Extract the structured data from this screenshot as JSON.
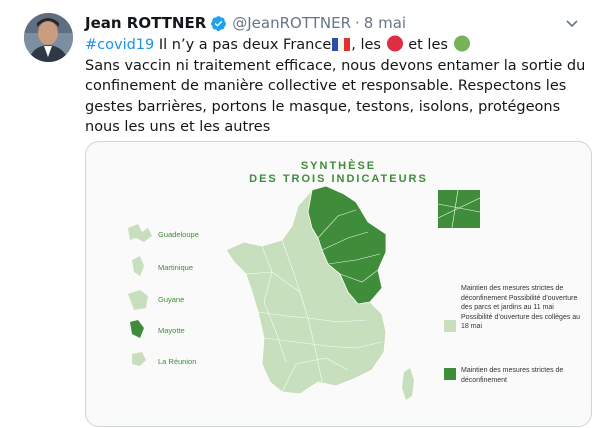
{
  "tweet": {
    "display_name": "Jean ROTTNER",
    "handle": "@JeanROTTNER",
    "separator": "·",
    "date": "8 mai",
    "text_hashtag": "#covid19",
    "text_line1_rest": " Il n’y a pas deux France",
    "text_line1_mid": ", les ",
    "text_line1_and": " et les ",
    "text_body": "Sans vaccin ni traitement efficace, nous devons entamer la sortie du confinement de manière collective et responsable. Respectons les gestes barrières, portons le masque, testons, isolons, protégeons nous les uns et les autres"
  },
  "icons": {
    "verified": "verified-badge-icon",
    "caret": "chevron-down-icon",
    "flag": "france-flag-emoji",
    "red": "red-circle-emoji",
    "green": "green-circle-emoji"
  },
  "image": {
    "title_line1": "SYNTHÈSE",
    "title_line2": "DES TROIS INDICATEURS",
    "territories": [
      "Guadeloupe",
      "Martinique",
      "Guyane",
      "Mayotte",
      "La Réunion"
    ],
    "legend": [
      {
        "color": "#c8dfbe",
        "text": "Maintien des mesures strictes de déconfinement Possibilité d’ouverture des parcs et jardins au 11 mai Possibilité d’ouverture des collèges au 18 mai"
      },
      {
        "color": "#3f8c3a",
        "text": "Maintien des mesures strictes de déconfinement"
      }
    ]
  },
  "colors": {
    "link": "#1b95e0",
    "muted": "#657786",
    "light_green": "#c8dfbe",
    "dark_green": "#3f8c3a"
  }
}
